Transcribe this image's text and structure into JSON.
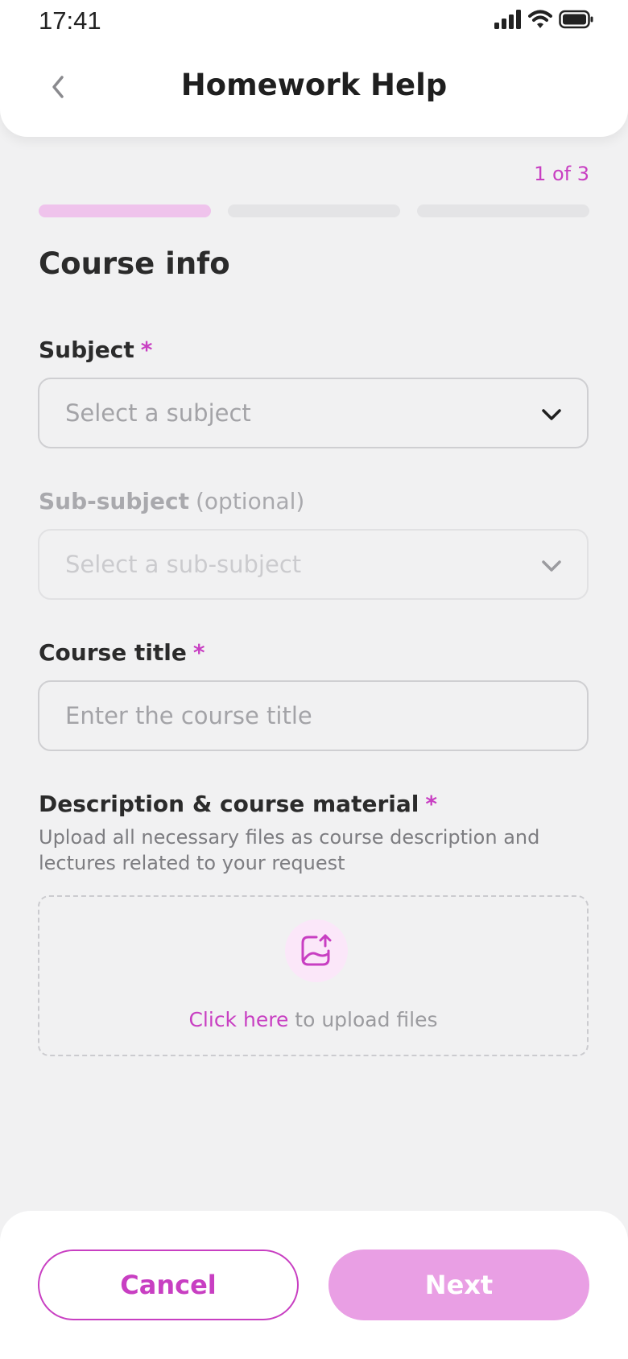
{
  "status_bar": {
    "time": "17:41"
  },
  "header": {
    "title": "Homework Help"
  },
  "progress": {
    "step_text": "1 of 3",
    "total_steps": 3,
    "current_step": 1
  },
  "section_title": "Course info",
  "fields": {
    "subject": {
      "label": "Subject",
      "required_mark": "*",
      "placeholder": "Select a subject"
    },
    "sub_subject": {
      "label": "Sub-subject",
      "optional": "(optional)",
      "placeholder": "Select a sub-subject"
    },
    "course_title": {
      "label": "Course title",
      "required_mark": "*",
      "placeholder": "Enter the course title"
    },
    "description": {
      "label": "Description & course material",
      "required_mark": "*",
      "help": "Upload all necessary files as course description and lectures related to your request"
    }
  },
  "upload": {
    "link_text": "Click here",
    "rest_text": "to upload files"
  },
  "footer": {
    "cancel_label": "Cancel",
    "next_label": "Next"
  },
  "colors": {
    "accent": "#c83fc2",
    "accent_light": "#efc3ec",
    "next_disabled": "#e99fe4"
  },
  "icons": [
    "back-chevron-icon",
    "signal-icon",
    "wifi-icon",
    "battery-icon",
    "chevron-down-icon",
    "upload-image-icon"
  ]
}
